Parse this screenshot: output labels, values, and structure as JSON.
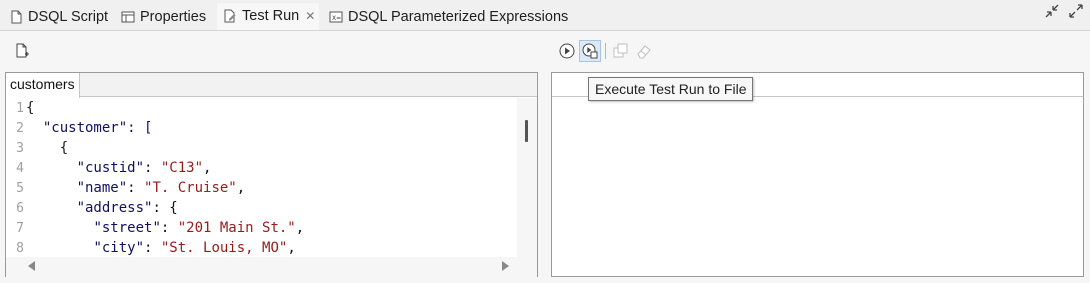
{
  "tabs": [
    {
      "label": "DSQL Script",
      "icon": "document-icon"
    },
    {
      "label": "Properties",
      "icon": "table-icon"
    },
    {
      "label": "Test Run",
      "icon": "edit-document-icon",
      "active": true,
      "closable": true
    },
    {
      "label": "DSQL Parameterized Expressions",
      "icon": "expression-icon"
    }
  ],
  "window_controls": {
    "minimize": "minimize-icon",
    "maximize": "maximize-icon"
  },
  "toolbar": {
    "left": [
      {
        "icon": "new-file-icon"
      }
    ],
    "right": [
      {
        "icon": "play-icon"
      },
      {
        "icon": "run-to-file-icon",
        "hovered": true
      },
      {
        "icon": "copy-icon",
        "disabled": true
      },
      {
        "icon": "eraser-icon",
        "disabled": true
      }
    ]
  },
  "left_panel": {
    "tab_label": "customers",
    "code_lines": [
      {
        "n": "1",
        "text": "{"
      },
      {
        "n": "2",
        "text": "  \"customer\": ["
      },
      {
        "n": "3",
        "text": "    {"
      },
      {
        "n": "4",
        "text": "      \"custid\": \"C13\","
      },
      {
        "n": "5",
        "text": "      \"name\": \"T. Cruise\","
      },
      {
        "n": "6",
        "text": "      \"address\": {"
      },
      {
        "n": "7",
        "text": "        \"street\": \"201 Main St.\","
      },
      {
        "n": "8",
        "text": "        \"city\": \"St. Louis, MO\","
      }
    ]
  },
  "tooltip": {
    "text": "Execute Test Run to File"
  },
  "colors": {
    "key": "#101060",
    "string": "#9a1a1a",
    "line_number": "#a0a0a0",
    "border": "#9a9a9a"
  }
}
